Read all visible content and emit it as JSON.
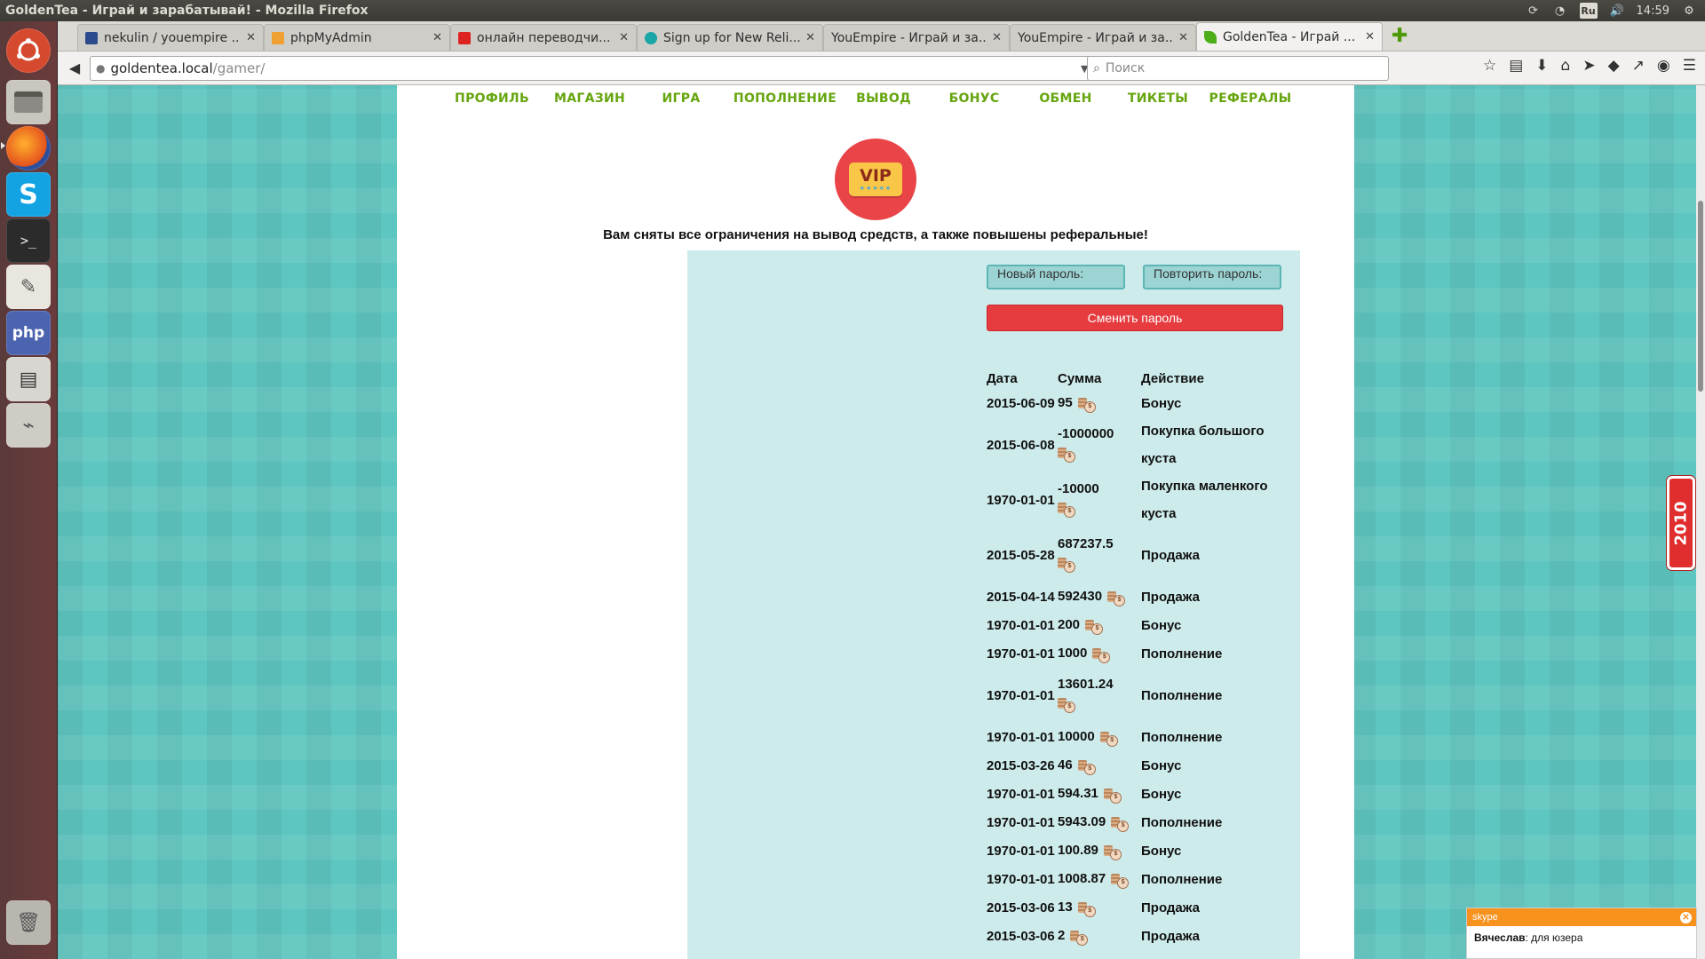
{
  "window": {
    "title": "GoldenTea - Играй и зарабатывай! - Mozilla Firefox"
  },
  "system": {
    "lang": "Ru",
    "time": "14:59"
  },
  "tabs": [
    {
      "label": "nekulin / youempire ...",
      "favicon_color": "#2b4b8c"
    },
    {
      "label": "phpMyAdmin",
      "favicon_color": "#f0a030"
    },
    {
      "label": "онлайн переводчи...",
      "favicon_color": "#d22"
    },
    {
      "label": "Sign up for New Reli...",
      "favicon_color": "#1aa6a6"
    },
    {
      "label": "YouEmpire - Играй и за...",
      "favicon_color": "#cfcdc8"
    },
    {
      "label": "YouEmpire - Играй и за...",
      "favicon_color": "#cfcdc8"
    },
    {
      "label": "GoldenTea - Играй ...",
      "favicon_color": "#4caf1a"
    }
  ],
  "url": {
    "host": "goldentea.local",
    "path": "/gamer/"
  },
  "search": {
    "placeholder": "Поиск"
  },
  "menu": [
    "ПРОФИЛЬ",
    "МАГАЗИН",
    "ИГРА",
    "ПОПОЛНЕНИЕ",
    "ВЫВОД",
    "БОНУС",
    "ОБМЕН",
    "ТИКЕТЫ",
    "РЕФЕРАЛЫ"
  ],
  "vip": {
    "badge_text": "VIP",
    "stars": "★★★★★",
    "message": "Вам сняты все ограничения на вывод средств, а также повышены реферальные!"
  },
  "password": {
    "new_placeholder": "Новый пароль:",
    "repeat_placeholder": "Повторить пароль:",
    "change_button": "Сменить пароль"
  },
  "history": {
    "headers": [
      "Дата",
      "Сумма",
      "Действие"
    ],
    "rows": [
      {
        "date": "2015-06-09",
        "amount": "95",
        "action": "Бонус"
      },
      {
        "date": "2015-06-08",
        "amount": "-1000000",
        "action": "Покупка большого куста"
      },
      {
        "date": "1970-01-01",
        "amount": "-10000",
        "action": "Покупка маленкого куста"
      },
      {
        "date": "2015-05-28",
        "amount": "687237.5",
        "action": "Продажа"
      },
      {
        "date": "2015-04-14",
        "amount": "592430",
        "action": "Продажа"
      },
      {
        "date": "1970-01-01",
        "amount": "200",
        "action": "Бонус"
      },
      {
        "date": "1970-01-01",
        "amount": "1000",
        "action": "Пополнение"
      },
      {
        "date": "1970-01-01",
        "amount": "13601.24",
        "action": "Пополнение"
      },
      {
        "date": "1970-01-01",
        "amount": "10000",
        "action": "Пополнение"
      },
      {
        "date": "2015-03-26",
        "amount": "46",
        "action": "Бонус"
      },
      {
        "date": "1970-01-01",
        "amount": "594.31",
        "action": "Бонус"
      },
      {
        "date": "1970-01-01",
        "amount": "5943.09",
        "action": "Пополнение"
      },
      {
        "date": "1970-01-01",
        "amount": "100.89",
        "action": "Бонус"
      },
      {
        "date": "1970-01-01",
        "amount": "1008.87",
        "action": "Пополнение"
      },
      {
        "date": "2015-03-06",
        "amount": "13",
        "action": "Продажа"
      },
      {
        "date": "2015-03-06",
        "amount": "2",
        "action": "Продажа"
      }
    ]
  },
  "side_badge": "2010",
  "skype": {
    "brand": "skype",
    "sender": "Вячеслав",
    "message": ": для юзера"
  }
}
